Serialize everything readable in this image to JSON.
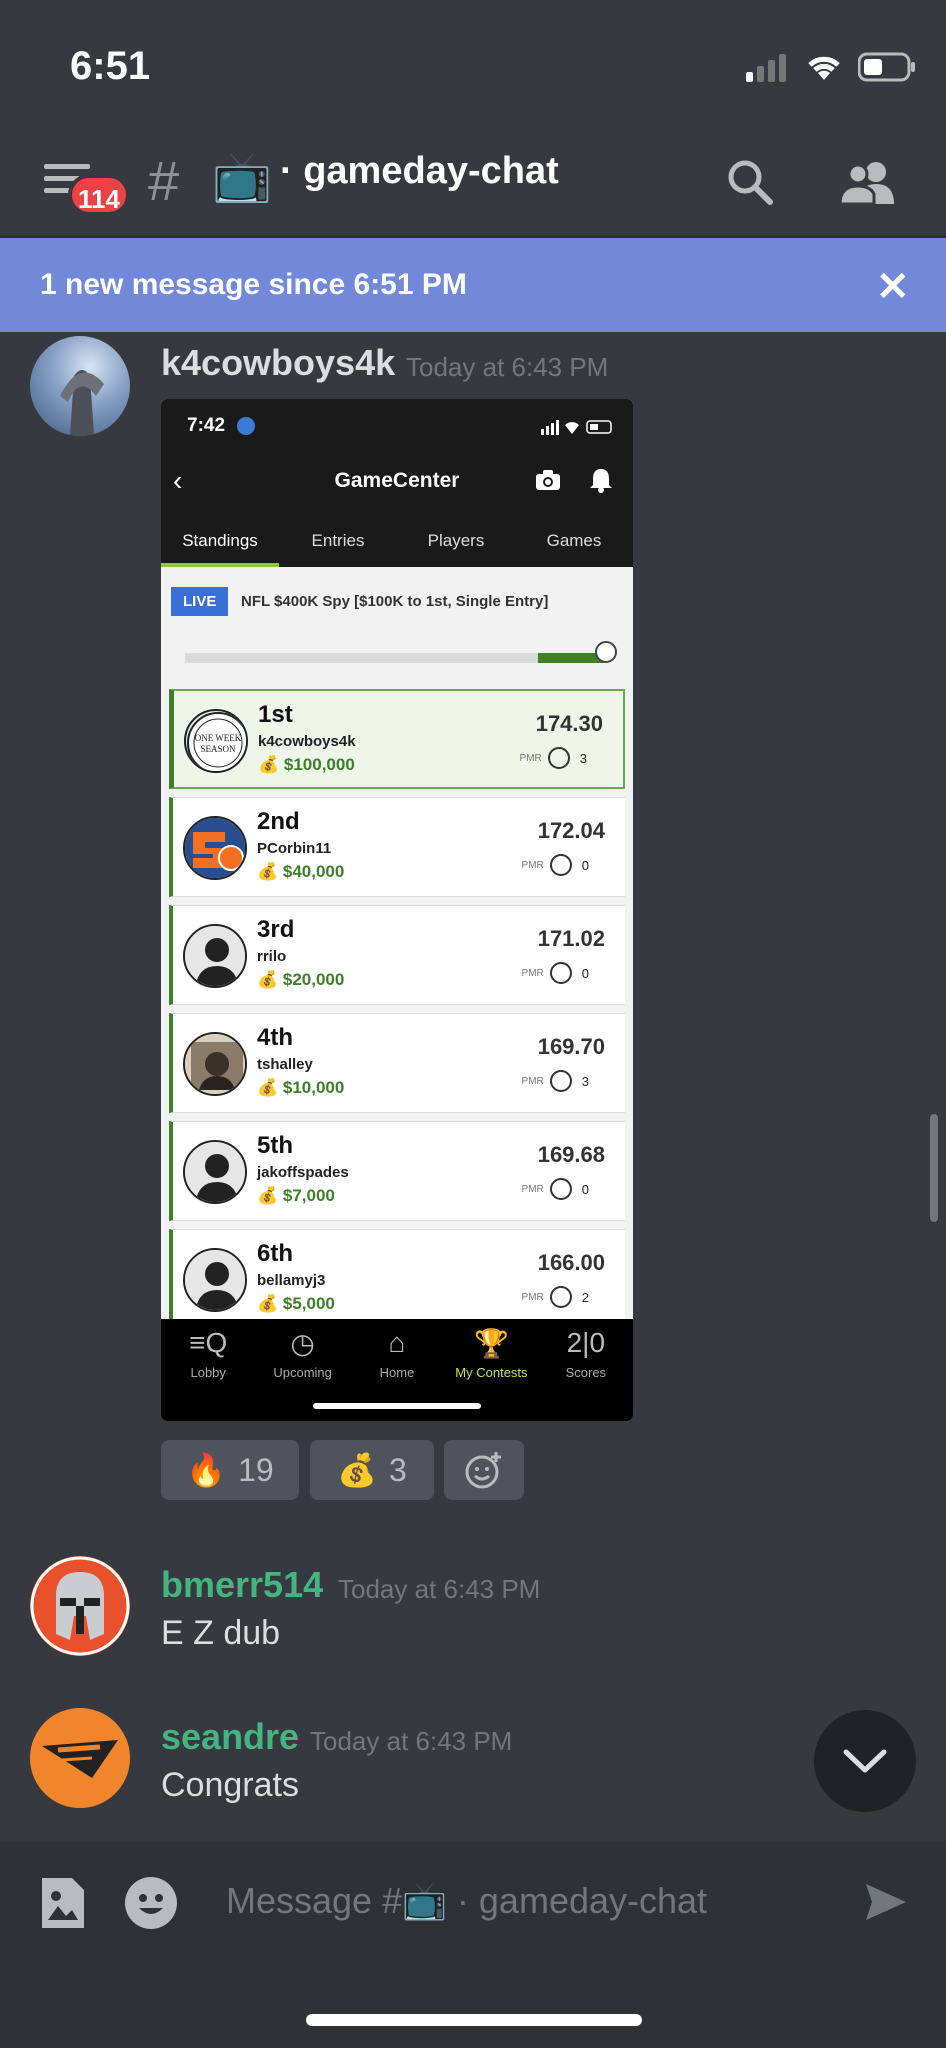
{
  "status_bar": {
    "time": "6:51"
  },
  "header": {
    "unread_count": "114",
    "hash": "#",
    "channel_emoji": "📺",
    "channel_name": "· gameday-chat"
  },
  "new_messages_bar": {
    "text": "1 new message since 6:51 PM",
    "close": "✕"
  },
  "messages": [
    {
      "username": "k4cowboys4k",
      "timestamp": "Today at 6:43 PM",
      "username_color": "#ffffff"
    },
    {
      "username": "bmerr514",
      "timestamp": "Today at 6:43 PM",
      "text": "E Z dub",
      "username_color": "#43b581"
    },
    {
      "username": "seandre",
      "timestamp": "Today at 6:43 PM",
      "text": "Congrats",
      "username_color": "#43b581"
    }
  ],
  "embed": {
    "time": "7:42",
    "title": "GameCenter",
    "tabs": [
      "Standings",
      "Entries",
      "Players",
      "Games"
    ],
    "live_label": "LIVE",
    "contest_name": "NFL $400K Spy [$100K to 1st, Single Entry]",
    "progress_fraction": 0.16,
    "pmr_label": "PMR",
    "standings": [
      {
        "rank": "1st",
        "name": "k4cowboys4k",
        "prize": "💰 $100,000",
        "score": "174.30",
        "pmr": "3",
        "avatar": "badge"
      },
      {
        "rank": "2nd",
        "name": "PCorbin11",
        "prize": "💰 $40,000",
        "score": "172.04",
        "pmr": "0",
        "avatar": "logo"
      },
      {
        "rank": "3rd",
        "name": "rrilo",
        "prize": "💰 $20,000",
        "score": "171.02",
        "pmr": "0",
        "avatar": "silhouette"
      },
      {
        "rank": "4th",
        "name": "tshalley",
        "prize": "💰 $10,000",
        "score": "169.70",
        "pmr": "3",
        "avatar": "photo"
      },
      {
        "rank": "5th",
        "name": "jakoffspades",
        "prize": "💰 $7,000",
        "score": "169.68",
        "pmr": "0",
        "avatar": "silhouette"
      },
      {
        "rank": "6th",
        "name": "bellamyj3",
        "prize": "💰 $5,000",
        "score": "166.00",
        "pmr": "2",
        "avatar": "silhouette"
      }
    ],
    "nav": [
      {
        "label": "Lobby",
        "icon": "≡Q"
      },
      {
        "label": "Upcoming",
        "icon": "◷"
      },
      {
        "label": "Home",
        "icon": "⌂"
      },
      {
        "label": "My Contests",
        "icon": "🏆"
      },
      {
        "label": "Scores",
        "icon": "2|0"
      }
    ],
    "badge_text": "ONE WEEK SEASON"
  },
  "reactions": [
    {
      "emoji": "🔥",
      "count": "19"
    },
    {
      "emoji": "💰",
      "count": "3"
    }
  ],
  "input": {
    "placeholder": "Message #📺 · gameday-chat"
  },
  "icons": {
    "menu": "hamburger-icon",
    "search": "search-icon",
    "members": "members-icon",
    "image": "image-attach-icon",
    "emoji": "emoji-icon",
    "send": "send-icon",
    "add_reaction": "add-reaction-icon",
    "jump": "chevron-down-icon"
  }
}
